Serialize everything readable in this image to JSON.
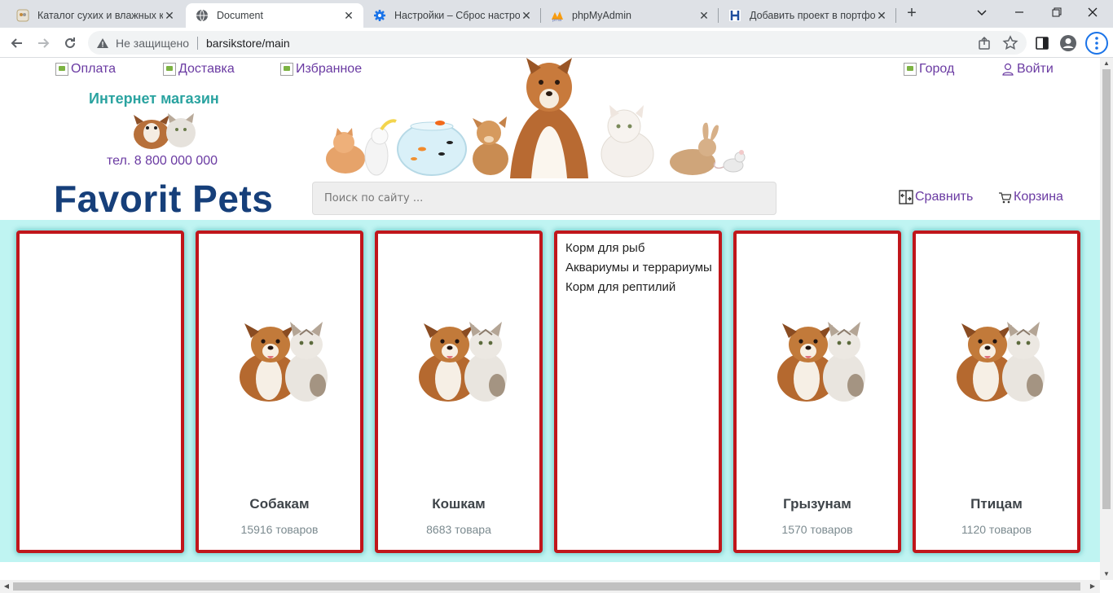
{
  "browser": {
    "tabs": [
      {
        "title": "Каталог сухих и влажных ко",
        "active": false,
        "icon": "catalog-favicon"
      },
      {
        "title": "Document",
        "active": true,
        "icon": "globe-icon"
      },
      {
        "title": "Настройки – Сброс настрое",
        "active": false,
        "icon": "gear-icon"
      },
      {
        "title": "phpMyAdmin",
        "active": false,
        "icon": "phpmyadmin-icon"
      },
      {
        "title": "Добавить проект в портфол",
        "active": false,
        "icon": "h-logo-icon"
      }
    ],
    "security_label": "Не защищено",
    "url": "barsikstore/main"
  },
  "header": {
    "links": {
      "payment": "Оплата",
      "delivery": "Доставка",
      "favorites": "Избранное",
      "city": "Город",
      "login": "Войти"
    },
    "shop_name": "Интернет магазин",
    "phone": "тел. 8 800 000 000",
    "brand": "Favorit Pets",
    "search_placeholder": "Поиск по сайту ...",
    "compare": "Сравнить",
    "cart": "Корзина"
  },
  "categories": [
    {
      "name": "",
      "count": ""
    },
    {
      "name": "Собакам",
      "count": "15916 товаров"
    },
    {
      "name": "Кошкам",
      "count": "8683 товара"
    },
    {
      "name": "",
      "count": "",
      "submenu": [
        "Корм для рыб",
        "Аквариумы и террариумы",
        "Корм для рептилий"
      ]
    },
    {
      "name": "Грызунам",
      "count": "1570 товаров"
    },
    {
      "name": "Птицам",
      "count": "1120 товаров"
    }
  ],
  "colors": {
    "brand": "#163f7a",
    "link": "#6a3aa2",
    "accent": "#2aa3a0",
    "card_border": "#c0161b",
    "band": "#bff4f2"
  }
}
